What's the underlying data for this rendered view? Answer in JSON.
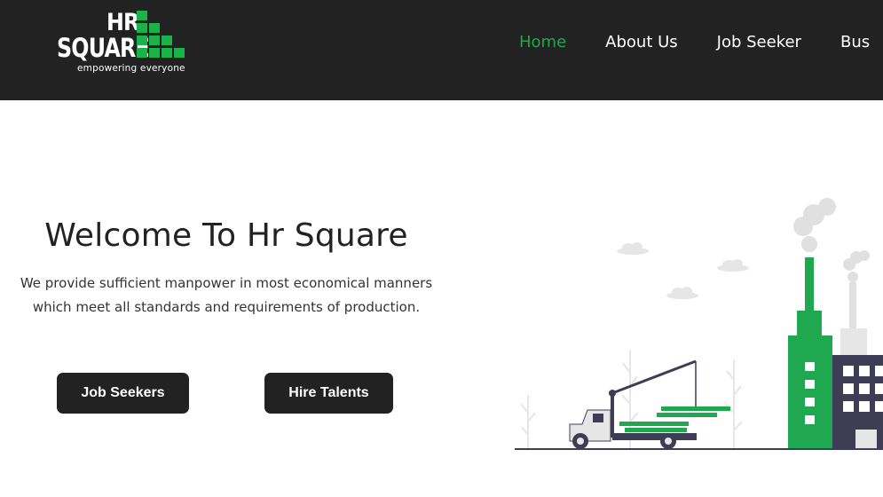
{
  "brand": {
    "logo_top": "HR",
    "logo_main": "SQUARE",
    "tagline": "empowering everyone",
    "accent_color": "#19b34a",
    "header_bg": "#222222"
  },
  "nav": {
    "items": [
      {
        "label": "Home",
        "active": true
      },
      {
        "label": "About Us",
        "active": false
      },
      {
        "label": "Job Seeker",
        "active": false
      },
      {
        "label": "Bus",
        "active": false
      }
    ]
  },
  "hero": {
    "title": "Welcome To Hr Square",
    "description_line1": "We provide sufficient manpower in most economical manners",
    "description_line2": "which meet all standards and requirements of production.",
    "buttons": {
      "job_seekers": "Job Seekers",
      "hire_talents": "Hire Talents"
    }
  },
  "illustration": {
    "icon": "factory-truck-crane-illustration",
    "colors": {
      "green": "#1fa84f",
      "dark": "#3f3d56",
      "grey": "#e6e6e6"
    }
  }
}
